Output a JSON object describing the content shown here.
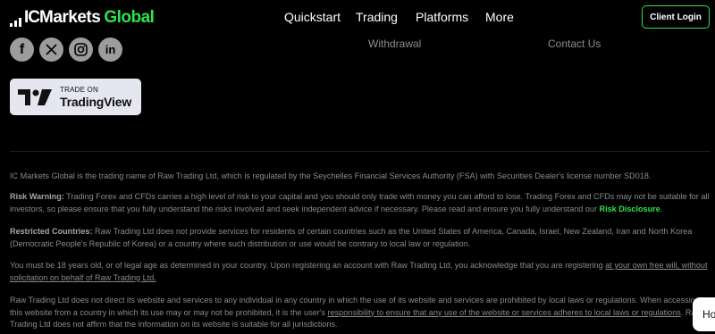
{
  "brand": {
    "prefix": "IC",
    "name": "Markets",
    "suffix": "Global"
  },
  "nav": {
    "items": [
      "Quickstart",
      "Trading",
      "Platforms",
      "More"
    ]
  },
  "header": {
    "client_login": "Client Login"
  },
  "footer_links": {
    "withdrawal": "Withdrawal",
    "contact": "Contact Us"
  },
  "social": {
    "icons": [
      "facebook-icon",
      "x-icon",
      "instagram-icon",
      "linkedin-icon"
    ],
    "facebook": "f",
    "linkedin": "in"
  },
  "tradingview": {
    "small": "TRADE ON",
    "big": "TradingView",
    "mark": "TV"
  },
  "legal": {
    "p1": "IC Markets Global is the trading name of Raw Trading Ltd, which is regulated by the Seychelles Financial Services Authority (FSA) with Securities Dealer's license number SD018.",
    "p2_label": "Risk Warning:",
    "p2_text": " Trading Forex and CFDs carries a high level of risk to your capital and you should only trade with money you can afford to lose. Trading Forex and CFDs may not be suitable for all investors, so please ensure that you fully understand the risks involved and seek independent advice if necessary. Please read and ensure you fully understand our ",
    "p2_link": "Risk Disclosure",
    "p2_end": ".",
    "p3_label": "Restricted Countries:",
    "p3_text": " Raw Trading Ltd does not provide services for residents of certain countries such as the United States of America, Canada, Israel, New Zealand, Iran and North Korea (Democratic People's Republic of Korea) or a country where such distribution or use would be contrary to local law or regulation.",
    "p4_text": "You must be 18 years old, or of legal age as determined in your country. Upon registering an account with Raw Trading Ltd, you acknowledge that you are registering ",
    "p4_link": "at your own free will, without solicitation on behalf of Raw Trading Ltd.",
    "p5_text1": "Raw Trading Ltd does not direct its website and services to any individual in any country in which the use of its website and services are prohibited by local laws or regulations. When accessing this website from a country in which its use may or may not be prohibited, it is the user's ",
    "p5_link": "responsibility to ensure that any use of the website or services adheres to local laws or regulations",
    "p5_text2": ". Raw Trading Ltd does not affirm that the information on its website is suitable for all jurisdictions."
  },
  "chat": {
    "label": "Ho"
  },
  "colors": {
    "accent": "#2ee24b",
    "background": "#000000"
  }
}
